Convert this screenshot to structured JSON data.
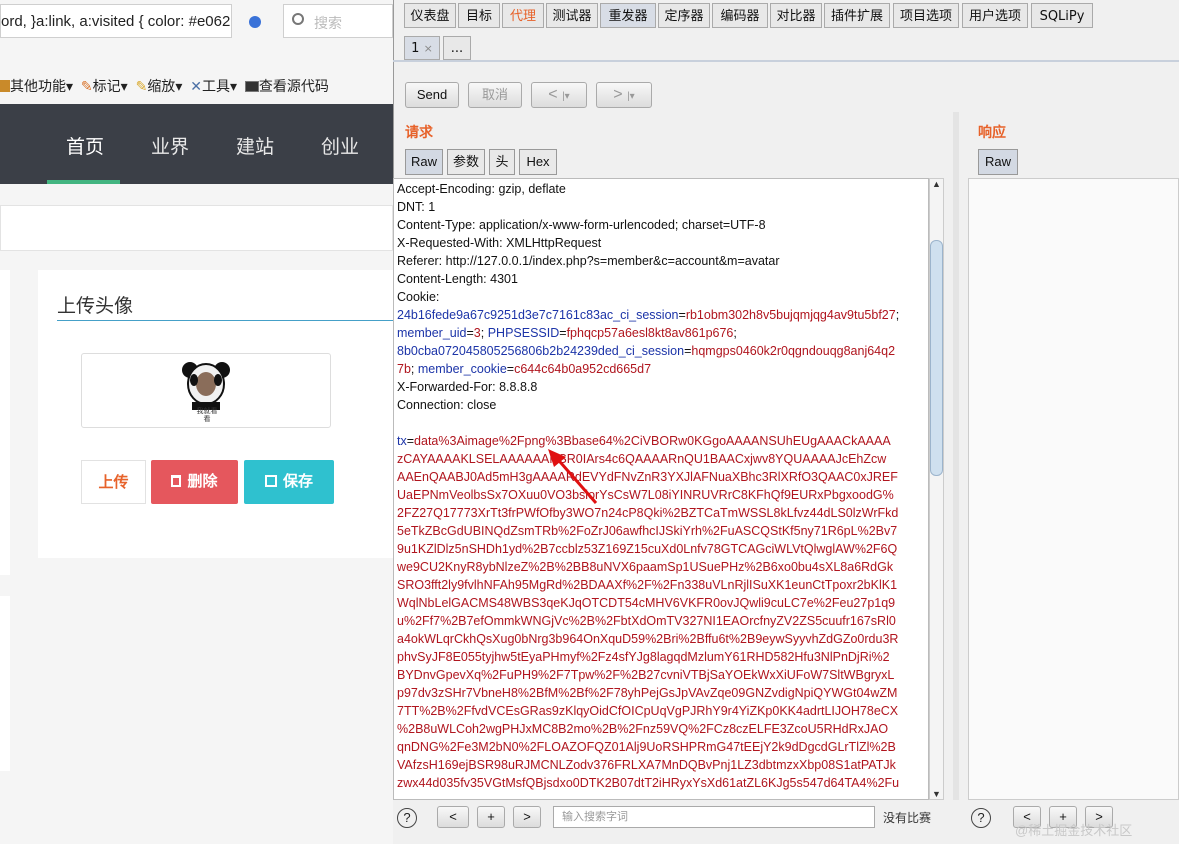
{
  "browser": {
    "address_text": "ord, }a:link, a:visited { color: #e06228; color: #404",
    "search_placeholder": "搜索",
    "toolbar": [
      {
        "label": "其他功能",
        "icon": "folder-icon"
      },
      {
        "label": "标记",
        "icon": "pencil-icon"
      },
      {
        "label": "缩放",
        "icon": "pencil-icon"
      },
      {
        "label": "工具",
        "icon": "tools-icon"
      },
      {
        "label": "查看源代码",
        "icon": "terminal-icon"
      }
    ],
    "nav": [
      "首页",
      "业界",
      "建站",
      "创业"
    ],
    "card_title": "上传头像",
    "avatar_caption": "我就看看",
    "buttons": {
      "upload": "上传",
      "delete": "删除",
      "save": "保存"
    },
    "colors": {
      "nav_bg": "#3b3f47",
      "nav_accent": "#43b581",
      "delete_bg": "#e5575d",
      "save_bg": "#2fc1cf",
      "upload_text": "#e7622a"
    }
  },
  "burp": {
    "main_tabs": [
      "仪表盘",
      "目标",
      "代理",
      "测试器",
      "重发器",
      "定序器",
      "编码器",
      "对比器",
      "插件扩展",
      "项目选项",
      "用户选项",
      "SQLiPy"
    ],
    "selected_tab": "重发器",
    "highlight_tab": "代理",
    "sub_tabs": [
      "1",
      "..."
    ],
    "sub_tab_close": "×",
    "send_label": "Send",
    "cancel_label": "取消",
    "prev_label": "<",
    "next_label": ">",
    "request_title": "请求",
    "response_title": "响应",
    "request_tabs": [
      "Raw",
      "参数",
      "头",
      "Hex"
    ],
    "response_tabs": [
      "Raw"
    ],
    "request_lines": [
      {
        "t": "Accept-Encoding: gzip, deflate",
        "c": "plain"
      },
      {
        "t": "DNT: 1",
        "c": "plain"
      },
      {
        "t": "Content-Type: application/x-www-form-urlencoded; charset=UTF-8",
        "c": "plain"
      },
      {
        "t": "X-Requested-With: XMLHttpRequest",
        "c": "plain"
      },
      {
        "t": "Referer: http://127.0.0.1/index.php?s=member&c=account&m=avatar",
        "c": "plain"
      },
      {
        "t": "Content-Length: 4301",
        "c": "plain"
      },
      {
        "t": "Cookie:",
        "c": "plain"
      }
    ],
    "cookie_lines": [
      [
        {
          "t": "24b16fede9a67c9251d3e7c7161c83ac_ci_session",
          "c": "blue"
        },
        {
          "t": "=",
          "c": "plain"
        },
        {
          "t": "rb1obm302h8v5bujqmjqg4av9tu5bf27",
          "c": "red"
        },
        {
          "t": ";",
          "c": "plain"
        }
      ],
      [
        {
          "t": " member_uid",
          "c": "blue"
        },
        {
          "t": "=",
          "c": "plain"
        },
        {
          "t": "3",
          "c": "red"
        },
        {
          "t": "; ",
          "c": "plain"
        },
        {
          "t": "PHPSESSID",
          "c": "blue"
        },
        {
          "t": "=",
          "c": "plain"
        },
        {
          "t": "fphqcp57a6esl8kt8av861p676",
          "c": "red"
        },
        {
          "t": ";",
          "c": "plain"
        }
      ],
      [
        {
          "t": "8b0cba072045805256806b2b24239ded_ci_session",
          "c": "blue"
        },
        {
          "t": "=",
          "c": "plain"
        },
        {
          "t": "hqmgps0460k2r0qgndouqg8anj64q2",
          "c": "red"
        }
      ],
      [
        {
          "t": "7b",
          "c": "red"
        },
        {
          "t": "; ",
          "c": "plain"
        },
        {
          "t": "member_cookie",
          "c": "blue"
        },
        {
          "t": "=",
          "c": "plain"
        },
        {
          "t": "c644c64b0a952cd665d7",
          "c": "red"
        }
      ]
    ],
    "after_cookie": [
      "X-Forwarded-For: 8.8.8.8",
      "Connection: close"
    ],
    "body_key": "tx",
    "body_lines": [
      "data%3Aimage%2Fpng%3Bbase64%2CiVBORw0KGgoAAAANSUhEUgAAACkAAAA",
      "zCAYAAAAKLSELAAAAAANSR0IArs4c6QAAAARnQU1BAACxjwv8YQUAAAAJcEhZcw",
      "AAEnQAABJ0Ad5mH3gAAAARdEVYdFNvZnR3YXJlAFNuaXBhc3RlXRfO3QAAC0xJREF",
      "UaEPNmVeolbsSx7OXuu0VO3bsiorYsCsW7L08iYINRUVRrC8KFhQf9EURxPbgxoodG%",
      "2FZ27Q17773XrTt3frPWfOfby3WO7n24cP8Qki%2BZTCaTmWSSL8kLfvz44dLS0lzWrFkd",
      "5eTkZBcGdUBINQdZsmTRb%2FoZrJ06awfhcIJSkiYrh%2FuASCQStKf5ny71R6pL%2Bv7",
      "9u1KZlDlz5nSHDh1yd%2B7ccblz53Z169Z15cuXd0Lnfv78GTCAGciWLVtQlwglAW%2F6Q",
      "we9CU2KnyR8ybNlzeZ%2B%2BB8uNVX6paamSp1USuePHz%2B6xo0bu4sXL8a6RdGk",
      "SRO3fft2ly9fvlhNFAh95MgRd%2BDAAXf%2F%2Fn338uVLnRjlISuXK1eunCtTpoxr2bKlK1",
      "WqlNbLelGACMS48WBS3qeKJqOTCDT54cMHV6VKFR0ovJQwli9cuLC7e%2Feu27p1q9",
      "u%2Ff7%2B7efOmmkWNGjVc%2B%2FbtXdOmTV327NI1EAOrcfnyZV2ZS5cuufr167sRl0",
      "a4okWLqrCkhQsXug0bNrg3b964OnXquD59%2Bri%2Bffu6t%2B9eywSyyvhZdGZo0rdu3R",
      "phvSyJF8E055tyjhw5tEyaPHmyf%2Fz4sfYJg8lagqdMzlumY61RHD582Hfu3NlPnDjRi%2",
      "BYDnvGpevXq%2FuPH9%2F7Tpw%2F%2B27cvniVTBjSaYOEkWxXiUFoW7SltWBgryxL",
      "p97dv3zSHr7VbneH8%2BfM%2Bf%2F78yhPejGsJpVAvZqe09GNZvdigNpiQYWGt04wZM",
      "7TT%2B%2FfvdVCEsGRas9zKlqyOidCfOICpUqVgPJRhY9r4YiZKp0KK4adrtLIJOH78eCX",
      "%2B8uWLCoh2wgPHJxMC8B2mo%2B%2Fnz59VQ%2FCz8czELFE3ZcoU5RHdRxJAO",
      "qnDNG%2Fe3M2bN0%2FLOAZOFQZ01Alj9UoRSHPRmG47tEEjY2k9dDgcdGLrTlZl%2B",
      "VAfzsH169ejBSR98uRJMCNLZodv376FRLXA7MnDQBvPnj1LZ3dbtmzxXbp08S1atPATJk",
      "zwx44d035fv35VGtMsfQBjsdxo0DTK2B07dtT2iHRyxYsXd61atZL6KJg5s547d64TA4%2Fu"
    ],
    "bottom_search_placeholder": "输入搜索字词",
    "bottom_match": "没有比赛",
    "bottom_help": "?",
    "bottom_prev": "<",
    "bottom_add": "+",
    "bottom_next": ">",
    "watermark": "@稀土掘金技术社区",
    "colors": {
      "accent": "#e7622a",
      "key_blue": "#1c34a8",
      "value_red": "#b0151e"
    }
  }
}
